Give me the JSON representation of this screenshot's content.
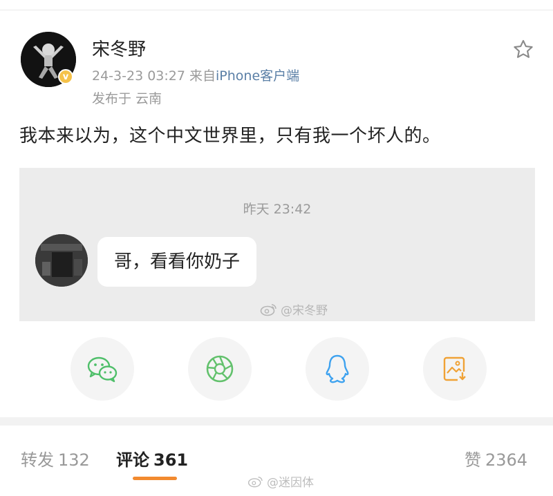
{
  "post": {
    "author": "宋冬野",
    "timestamp": "24-3-23 03:27",
    "source_prefix": "来自",
    "source_client": "iPhone客户端",
    "location": "发布于 云南",
    "text": "我本来以为，这个中文世界里，只有我一个坏人的。"
  },
  "embed": {
    "time": "昨天 23:42",
    "message": "哥，看看你奶子",
    "watermark": "@宋冬野"
  },
  "share": {
    "icons": [
      "wechat-icon",
      "moments-icon",
      "qq-icon",
      "save-image-icon"
    ],
    "colors": {
      "wechat": "#4fbf6a",
      "moments": "#62c16c",
      "qq": "#3ea2ef",
      "save": "#f0a236"
    }
  },
  "tabs": {
    "repost_label": "转发",
    "repost_count": "132",
    "comment_label": "评论",
    "comment_count": "361",
    "like_label": "赞",
    "like_count": "2364",
    "active": "comment",
    "accent": "#f28a2f"
  },
  "footer_watermark": "@迷因体"
}
